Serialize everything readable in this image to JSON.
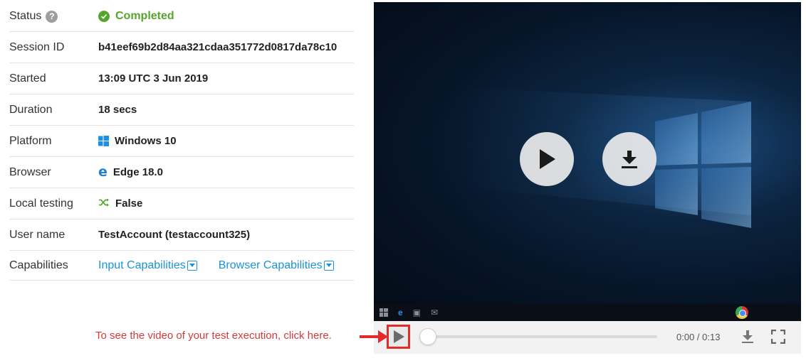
{
  "details": {
    "status": {
      "label": "Status",
      "help": "?",
      "value": "Completed"
    },
    "session_id": {
      "label": "Session ID",
      "value": "b41eef69b2d84aa321cdaa351772d0817da78c10"
    },
    "started": {
      "label": "Started",
      "value": "13:09 UTC 3 Jun 2019"
    },
    "duration": {
      "label": "Duration",
      "value": "18 secs"
    },
    "platform": {
      "label": "Platform",
      "value": "Windows 10",
      "icon": "windows-icon"
    },
    "browser": {
      "label": "Browser",
      "value": "Edge 18.0",
      "icon": "edge-icon"
    },
    "local_testing": {
      "label": "Local testing",
      "value": "False",
      "icon": "shuffle-icon"
    },
    "user_name": {
      "label": "User name",
      "value": "TestAccount (testaccount325)"
    },
    "capabilities": {
      "label": "Capabilities",
      "input": "Input Capabilities",
      "browser": "Browser Capabilities"
    }
  },
  "player": {
    "time": "0:00 / 0:13",
    "progress": 0,
    "icons": [
      "play-icon",
      "download-icon",
      "fullscreen-icon"
    ]
  },
  "annotation": {
    "text": "To see the video of your test execution, click here."
  },
  "colors": {
    "success": "#55a52c",
    "link": "#1a94d8",
    "annotation": "#d43a3a",
    "highlight_box": "#e52a2a"
  }
}
